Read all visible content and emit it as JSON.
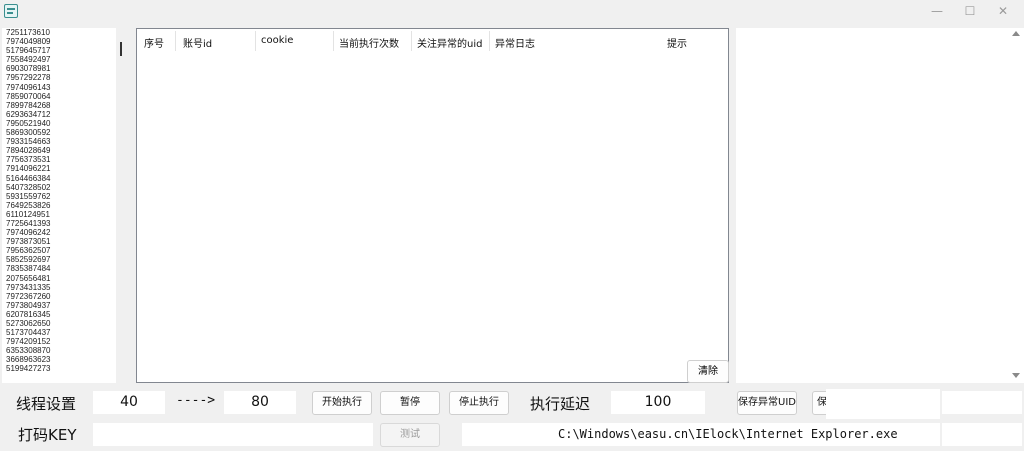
{
  "window": {
    "controls": {
      "minimize": "—",
      "maximize": "☐",
      "close": "✕"
    }
  },
  "uid_list": [
    "7251173610",
    "7974049809",
    "5179645717",
    "7558492497",
    "6903078981",
    "7957292278",
    "7974096143",
    "7859070064",
    "7899784268",
    "6293634712",
    "7950521940",
    "5869300592",
    "7933154663",
    "7894028649",
    "7756373531",
    "7914096221",
    "5164466384",
    "5407328502",
    "5931559762",
    "7649253826",
    "6110124951",
    "7725641393",
    "7974096242",
    "7973873051",
    "7956362507",
    "5852592697",
    "7835387484",
    "2075656481",
    "7973431335",
    "7972367260",
    "7973804937",
    "6207816345",
    "5273062650",
    "5173704437",
    "7974209152",
    "6353308870",
    "3668963623",
    "5199427273"
  ],
  "table": {
    "headers": [
      "序号",
      "账号id",
      "cookie",
      "当前执行次数",
      "关注异常的uid",
      "异常日志",
      "提示"
    ],
    "clear_label": "清除"
  },
  "controls": {
    "thread_label": "线程设置",
    "thread_from": "40",
    "arrow": "---->",
    "thread_to": "80",
    "start_label": "开始执行",
    "pause_label": "暂停",
    "stop_label": "停止执行",
    "delay_label": "执行延迟",
    "delay_value": "100",
    "save_uid_label": "保存异常UID",
    "save_partial_label": "保",
    "key_label": "打码KEY",
    "key_value": "",
    "test_label": "测试",
    "browser_path": "C:\\Windows\\easu.cn\\IElock\\Internet Explorer.exe"
  }
}
